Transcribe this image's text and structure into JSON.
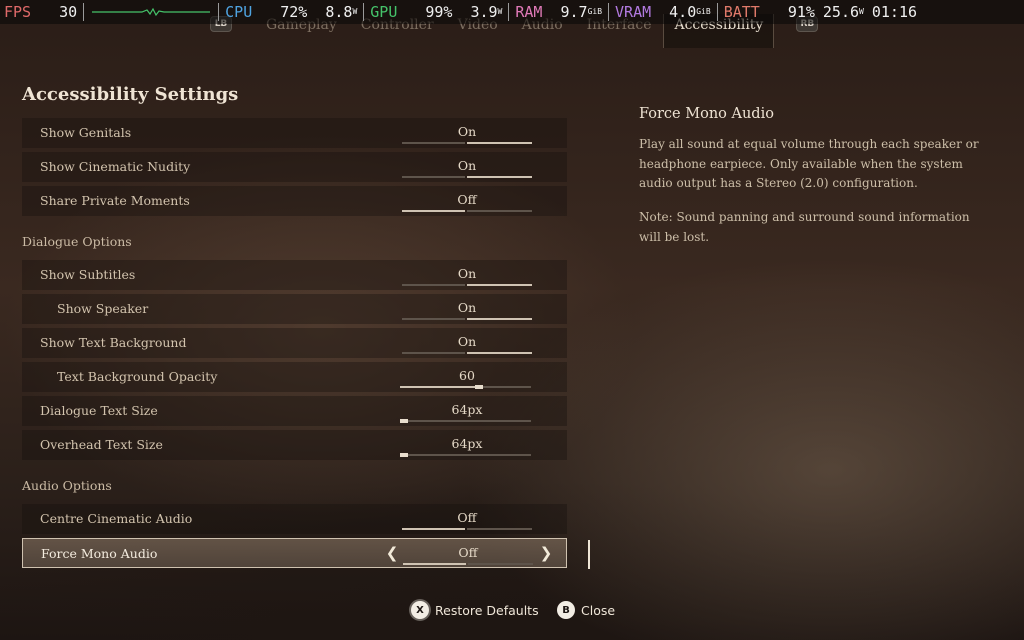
{
  "overlay": {
    "fps_label": "FPS",
    "fps_value": "30",
    "cpu_label": "CPU",
    "cpu_pct": "72%",
    "cpu_watts": "8.8",
    "cpu_unit": "W",
    "gpu_label": "GPU",
    "gpu_pct": "99%",
    "gpu_watts": "3.9",
    "gpu_unit": "W",
    "ram_label": "RAM",
    "ram_value": "9.7",
    "ram_unit": "GiB",
    "vram_label": "VRAM",
    "vram_value": "4.0",
    "vram_unit": "GiB",
    "batt_label": "BATT",
    "batt_pct": "91%",
    "batt_watts": "25.6",
    "batt_unit": "W",
    "time": "01:16",
    "colors": {
      "fps": "#e06a6a",
      "cpu": "#4fa3e0",
      "gpu": "#45c36a",
      "ram": "#e07ab8",
      "vram": "#b27ae0",
      "batt": "#e07a6a"
    }
  },
  "tabs": {
    "left_bumper": "LB",
    "right_bumper": "RB",
    "items": [
      "Gameplay",
      "Controller",
      "Video",
      "Audio",
      "Interface",
      "Accessibility"
    ],
    "active": "Accessibility"
  },
  "settings": {
    "title": "Accessibility Settings",
    "rows_top": [
      {
        "label": "Show Genitals",
        "value": "On"
      },
      {
        "label": "Show Cinematic Nudity",
        "value": "On"
      },
      {
        "label": "Share Private Moments",
        "value": "Off"
      }
    ],
    "dialogue_header": "Dialogue Options",
    "rows_dialogue": [
      {
        "label": "Show Subtitles",
        "value": "On"
      },
      {
        "label": "Show Speaker",
        "value": "On"
      },
      {
        "label": "Show Text Background",
        "value": "On"
      },
      {
        "label": "Text Background Opacity",
        "value": "60",
        "level": 0.6
      },
      {
        "label": "Dialogue Text Size",
        "value": "64px",
        "level": 0.0
      },
      {
        "label": "Overhead Text Size",
        "value": "64px",
        "level": 0.0
      }
    ],
    "audio_header": "Audio Options",
    "rows_audio": [
      {
        "label": "Centre Cinematic Audio",
        "value": "Off"
      },
      {
        "label": "Force Mono Audio",
        "value": "Off",
        "selected": true
      }
    ],
    "arrow_left": "❮",
    "arrow_right": "❯"
  },
  "description": {
    "title": "Force Mono Audio",
    "body": "Play all sound at equal volume through each speaker or headphone earpiece. Only available when the system audio output has a Stereo (2.0) configuration.",
    "note": "Note: Sound panning and surround sound information will be lost."
  },
  "footer": {
    "restore_icon": "X",
    "restore_label": "Restore Defaults",
    "close_icon": "B",
    "close_label": "Close"
  }
}
